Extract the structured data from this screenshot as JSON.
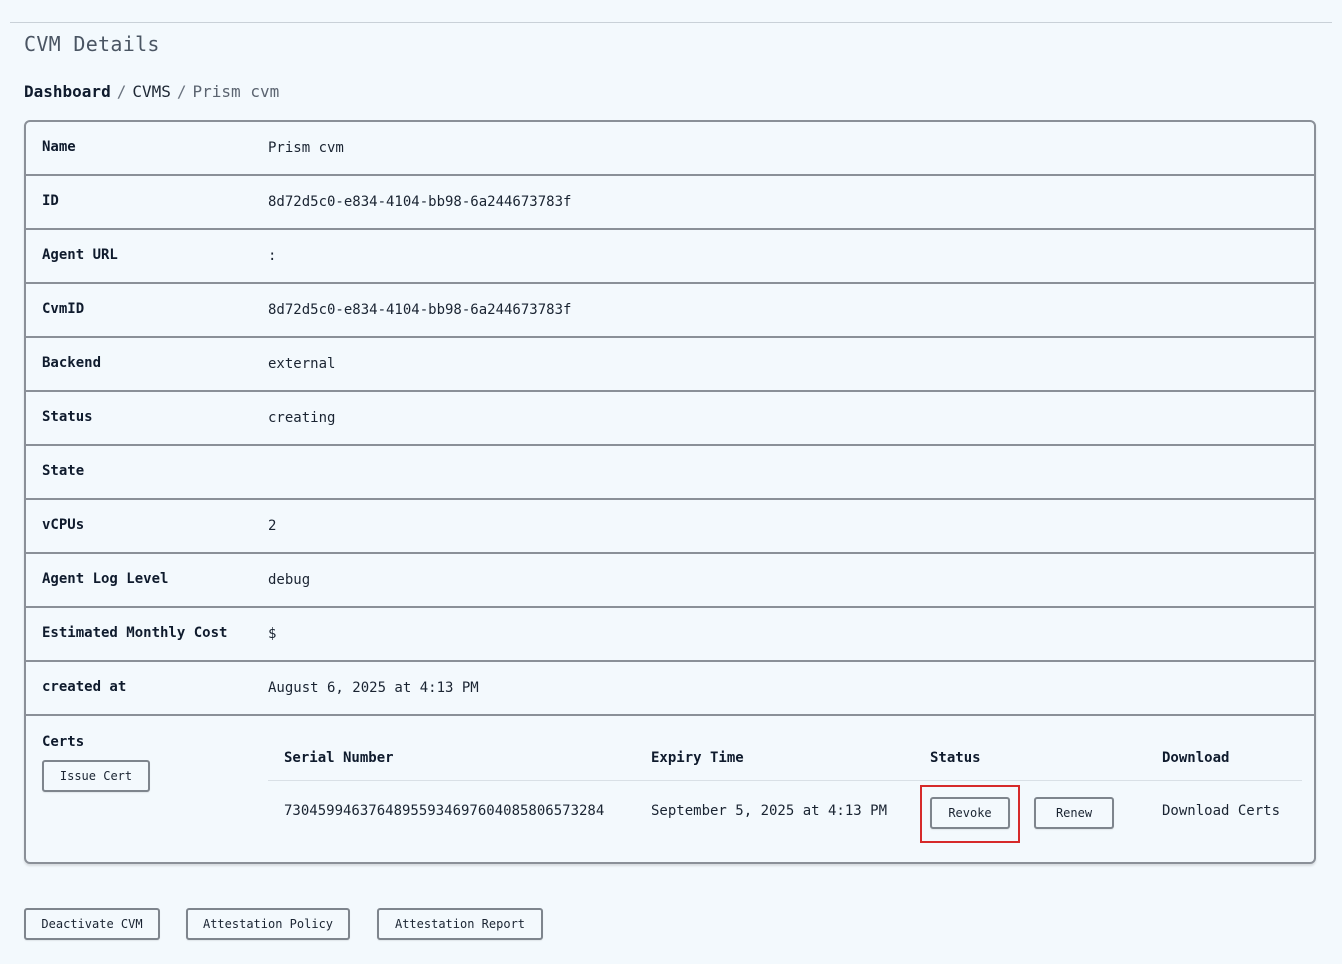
{
  "page": {
    "title": "CVM Details"
  },
  "breadcrumb": {
    "items": [
      "Dashboard",
      "CVMS",
      "Prism cvm"
    ],
    "separator": "/"
  },
  "details": {
    "rows": [
      {
        "label": "Name",
        "value": "Prism cvm"
      },
      {
        "label": "ID",
        "value": "8d72d5c0-e834-4104-bb98-6a244673783f"
      },
      {
        "label": "Agent URL",
        "value": ":"
      },
      {
        "label": "CvmID",
        "value": "8d72d5c0-e834-4104-bb98-6a244673783f"
      },
      {
        "label": "Backend",
        "value": "external"
      },
      {
        "label": "Status",
        "value": "creating"
      },
      {
        "label": "State",
        "value": ""
      },
      {
        "label": "vCPUs",
        "value": "2"
      },
      {
        "label": "Agent Log Level",
        "value": "debug"
      },
      {
        "label": "Estimated Monthly Cost",
        "value": "$"
      },
      {
        "label": "created at",
        "value": "August 6, 2025 at 4:13 PM"
      }
    ]
  },
  "certs": {
    "label": "Certs",
    "issue_button": "Issue Cert",
    "columns": [
      "Serial Number",
      "Expiry Time",
      "Status",
      "Download"
    ],
    "rows": [
      {
        "serial_number": "730459946376489559346976040858065 73284",
        "expiry_time": "September 5, 2025 at 4:13 PM",
        "revoke_label": "Revoke",
        "renew_label": "Renew",
        "download_label": "Download Certs"
      }
    ]
  },
  "actions": {
    "deactivate_label": "Deactivate CVM",
    "policy_label": "Attestation Policy",
    "report_label": "Attestation Report"
  },
  "colors": {
    "background": "#f3f9fd",
    "border": "#8a9098",
    "highlight": "#d62a2a"
  }
}
